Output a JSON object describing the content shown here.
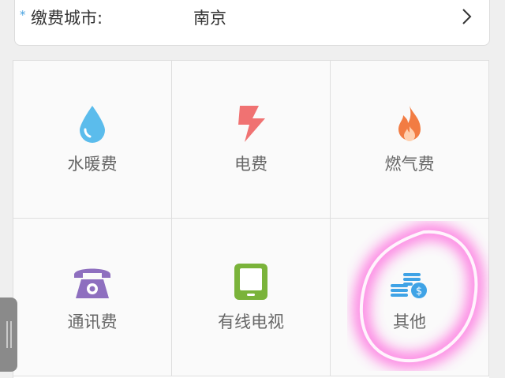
{
  "city": {
    "label": "缴费城市:",
    "value": "南京",
    "required_mark": "*"
  },
  "tiles": [
    {
      "label": "水暖费",
      "icon": "water-drop-icon",
      "color": "#5bbcec"
    },
    {
      "label": "电费",
      "icon": "lightning-icon",
      "color": "#f07272"
    },
    {
      "label": "燃气费",
      "icon": "flame-icon",
      "color": "#f27c43"
    },
    {
      "label": "通讯费",
      "icon": "telephone-icon",
      "color": "#8e6fbf"
    },
    {
      "label": "有线电视",
      "icon": "tv-tablet-icon",
      "color": "#7ab33a"
    },
    {
      "label": "其他",
      "icon": "coins-icon",
      "color": "#3fa3e6"
    }
  ],
  "colors": {
    "accent": "#4aa3e0",
    "highlight": "#ff4fd8"
  }
}
